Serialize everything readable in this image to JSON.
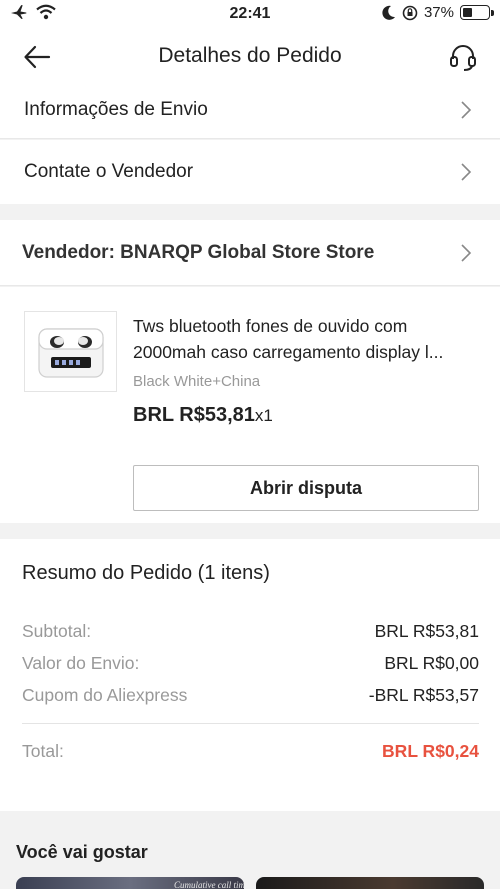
{
  "status_bar": {
    "time": "22:41",
    "battery": "37%",
    "battery_level": 0.37
  },
  "header": {
    "title": "Detalhes do Pedido",
    "back_icon": "arrow-left-icon",
    "support_icon": "headset-icon"
  },
  "menu": {
    "shipping_info": "Informações de Envio",
    "contact_seller": "Contate o Vendedor"
  },
  "seller": {
    "label": "Vendedor: BNARQP Global Store Store"
  },
  "product": {
    "title_line1": "Tws bluetooth fones de ouvido com",
    "title_line2": "2000mah caso carregamento display l...",
    "variant": "Black White+China",
    "price": "BRL R$53,81",
    "quantity": "x1",
    "dispute_button": "Abrir disputa"
  },
  "summary": {
    "title": "Resumo do Pedido (1 itens)",
    "subtotal_label": "Subtotal:",
    "subtotal_value": "BRL R$53,81",
    "shipping_label": "Valor do Envio:",
    "shipping_value": "BRL R$0,00",
    "coupon_label": "Cupom do Aliexpress",
    "coupon_value": "-BRL R$53,57",
    "total_label": "Total:",
    "total_value": "BRL R$0,24",
    "total_color": "#e8523f"
  },
  "recommendations": {
    "title": "Você vai gostar",
    "card1_caption": "Cumulative call time"
  }
}
